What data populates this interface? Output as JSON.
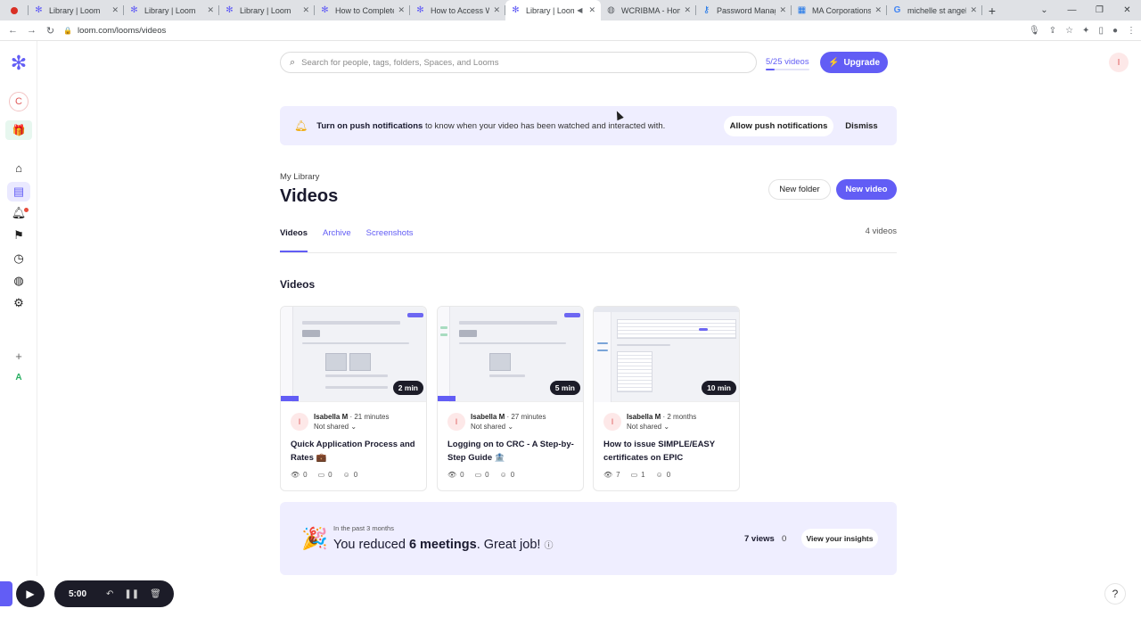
{
  "browser": {
    "tabs": [
      {
        "title": "Library | Loom",
        "icon": "loom-icon",
        "active": false
      },
      {
        "title": "Library | Loom",
        "icon": "loom-icon",
        "active": false
      },
      {
        "title": "Library | Loom",
        "icon": "loom-icon",
        "active": false
      },
      {
        "title": "How to Complete",
        "icon": "loom-icon",
        "active": false
      },
      {
        "title": "How to Access W",
        "icon": "loom-icon",
        "active": false
      },
      {
        "title": "Library | Loom",
        "icon": "loom-icon",
        "active": true
      },
      {
        "title": "WCRIBMA - Home",
        "icon": "globe-icon",
        "active": false
      },
      {
        "title": "Password Manage",
        "icon": "key-icon",
        "active": false
      },
      {
        "title": "MA Corporations",
        "icon": "chart-icon",
        "active": false
      },
      {
        "title": "michelle st angelo",
        "icon": "google-icon",
        "active": false
      }
    ],
    "url": "loom.com/looms/videos"
  },
  "header": {
    "search_placeholder": "Search for people, tags, folders, Spaces, and Looms",
    "video_count": "5/25 videos",
    "video_quota_fraction": 0.2,
    "upgrade_label": "Upgrade",
    "avatar_initial": "I"
  },
  "rail": {
    "workspace_initial": "C",
    "bottom_initial": "A",
    "plus": "+"
  },
  "banner": {
    "bold": "Turn on push notifications",
    "text": " to know when your video has been watched and interacted with.",
    "allow_label": "Allow push notifications",
    "dismiss_label": "Dismiss"
  },
  "library": {
    "breadcrumb": "My Library",
    "title": "Videos",
    "new_folder_label": "New folder",
    "new_video_label": "New video",
    "tabs": [
      "Videos",
      "Archive",
      "Screenshots"
    ],
    "count_label": "4 videos",
    "section_title": "Videos"
  },
  "videos": [
    {
      "duration": "2 min",
      "author": "Isabella M",
      "time": " · 21 minutes",
      "shared": "Not shared",
      "title": "Quick Application Process and Rates 💼",
      "views": "0",
      "comments": "0",
      "reactions": "0",
      "initial": "I"
    },
    {
      "duration": "5 min",
      "author": "Isabella M",
      "time": " · 27 minutes",
      "shared": "Not shared",
      "title": "Logging on to CRC - A Step-by-Step Guide 🏦",
      "views": "0",
      "comments": "0",
      "reactions": "0",
      "initial": "I"
    },
    {
      "duration": "10 min",
      "author": "Isabella M",
      "time": " · 2 months",
      "shared": "Not shared",
      "title": "How to issue SIMPLE/EASY certificates on EPIC",
      "views": "7",
      "comments": "1",
      "reactions": "0",
      "initial": "I"
    }
  ],
  "insights": {
    "period": "In the past 3 months",
    "main_prefix": "You reduced ",
    "main_bold": "6 meetings",
    "main_suffix": ". Great job!",
    "views": "7 views",
    "zero": "0",
    "button_label": "View your insights"
  },
  "recorder": {
    "time": "5:00"
  },
  "colors": {
    "accent": "#625df5",
    "banner_bg": "#efeeff"
  }
}
